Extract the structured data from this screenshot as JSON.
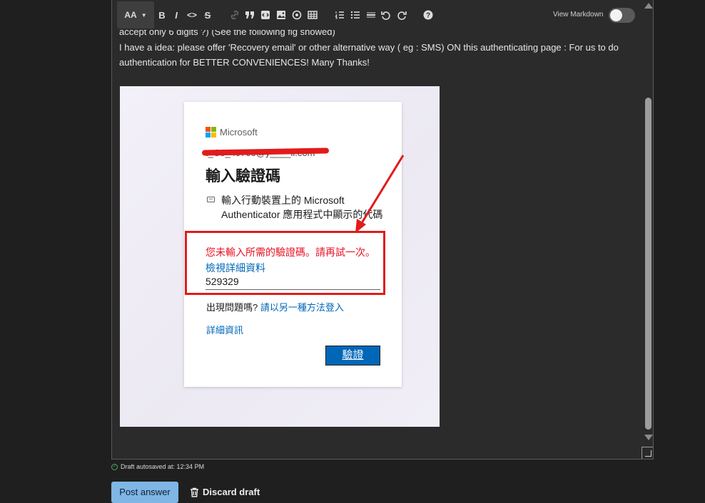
{
  "toolbar": {
    "text_size_label": "AA",
    "bold": "B",
    "italic": "I",
    "code": "<>",
    "strike": "S",
    "view_markdown_label": "View Markdown"
  },
  "content": {
    "cut_line": "accept only 6 digits ?) (See the following fig showed)",
    "paragraph": "I have a idea: please offer 'Recovery email' or other alternative way ( eg : SMS)   ON this authenticating page : For us to do authentication for BETTER CONVENIENCES! Many Thanks!"
  },
  "screenshot": {
    "brand": "Microsoft",
    "email": "t_C0_40700@y____il.com",
    "title": "輸入驗證碼",
    "description": "輸入行動裝置上的 Microsoft Authenticator 應用程式中顯示的代碼",
    "error_text": "您未輸入所需的驗證碼。請再試一次。",
    "error_link": "檢視詳細資料",
    "code_value": "529329",
    "help_prefix": "出現問題嗎? ",
    "help_link": "請以另一種方法登入",
    "more_info": "詳細資訊",
    "verify_button": "驗證"
  },
  "footer": {
    "autosave": "Draft autosaved at: 12:34 PM",
    "post_answer": "Post answer",
    "discard_draft": "Discard draft"
  }
}
